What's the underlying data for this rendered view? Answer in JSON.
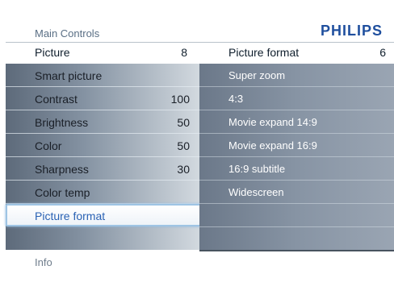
{
  "header": {
    "title": "Main Controls",
    "brand": "PHILIPS"
  },
  "breadcrumb": {
    "menu_label": "Picture",
    "menu_value": "8",
    "submenu_label": "Picture format",
    "submenu_value": "6"
  },
  "left_menu": {
    "items": [
      {
        "label": "Smart picture",
        "value": ""
      },
      {
        "label": "Contrast",
        "value": "100"
      },
      {
        "label": "Brightness",
        "value": "50"
      },
      {
        "label": "Color",
        "value": "50"
      },
      {
        "label": "Sharpness",
        "value": "30"
      },
      {
        "label": "Color temp",
        "value": ""
      },
      {
        "label": "Picture format",
        "value": ""
      }
    ],
    "selected_index": 6
  },
  "right_menu": {
    "items": [
      {
        "label": "Super zoom"
      },
      {
        "label": "4:3"
      },
      {
        "label": "Movie expand 14:9"
      },
      {
        "label": "Movie expand 16:9"
      },
      {
        "label": "16:9 subtitle"
      },
      {
        "label": "Widescreen"
      }
    ]
  },
  "footer": {
    "info": "Info"
  },
  "colors": {
    "brand": "#1f4f9e",
    "selected_text": "#2a62b4",
    "selected_border": "#9ec4e4"
  }
}
